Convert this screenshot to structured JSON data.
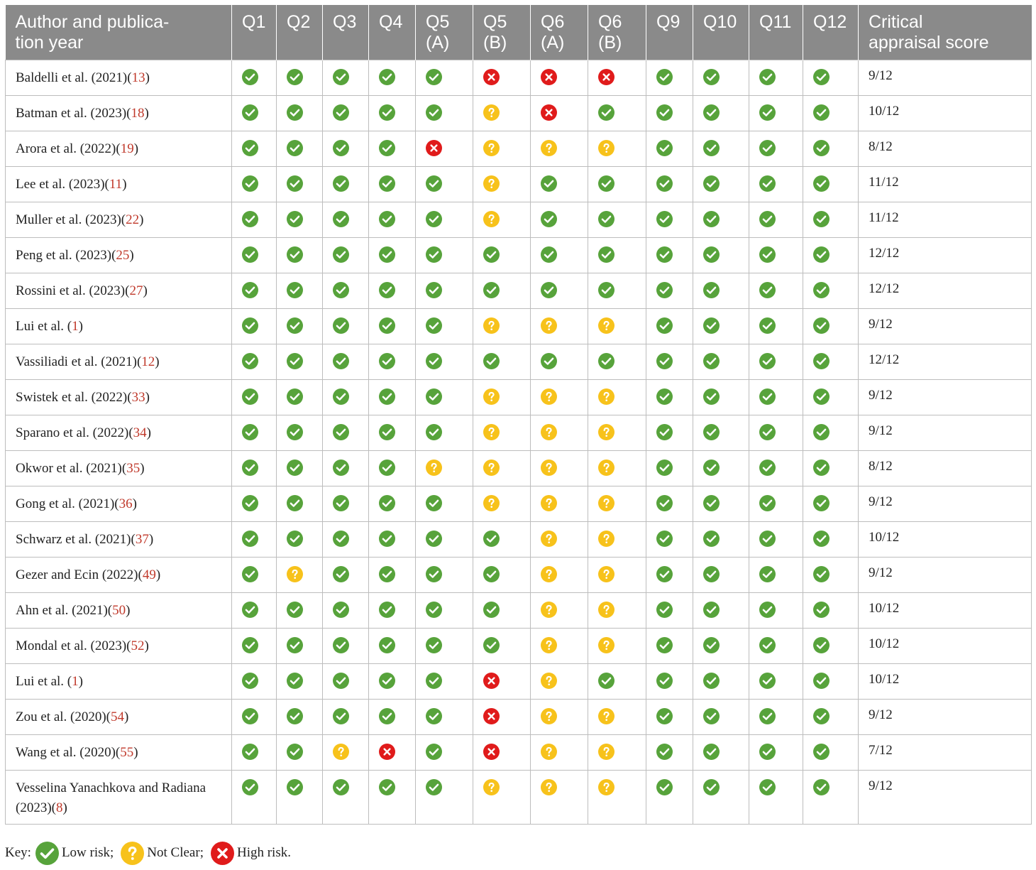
{
  "header": {
    "author": [
      "Author and publica-",
      "tion year"
    ],
    "questions": [
      [
        "Q1"
      ],
      [
        "Q2"
      ],
      [
        "Q3"
      ],
      [
        "Q4"
      ],
      [
        "Q5",
        "(A)"
      ],
      [
        "Q5",
        "(B)"
      ],
      [
        "Q6",
        "(A)"
      ],
      [
        "Q6",
        "(B)"
      ],
      [
        "Q9"
      ],
      [
        "Q10"
      ],
      [
        "Q11"
      ],
      [
        "Q12"
      ]
    ],
    "score": [
      "Critical",
      "appraisal score"
    ]
  },
  "rows": [
    {
      "author": "Baldelli et al. (2021)(",
      "ref": "13",
      "close": ")",
      "marks": [
        "low",
        "low",
        "low",
        "low",
        "low",
        "high",
        "high",
        "high",
        "low",
        "low",
        "low",
        "low"
      ],
      "score": "9/12"
    },
    {
      "author": "Batman et al. (2023)(",
      "ref": "18",
      "close": ")",
      "marks": [
        "low",
        "low",
        "low",
        "low",
        "low",
        "unclear",
        "high",
        "low",
        "low",
        "low",
        "low",
        "low"
      ],
      "score": "10/12"
    },
    {
      "author": "Arora et al. (2022)(",
      "ref": "19",
      "close": ")",
      "marks": [
        "low",
        "low",
        "low",
        "low",
        "high",
        "unclear",
        "unclear",
        "unclear",
        "low",
        "low",
        "low",
        "low"
      ],
      "score": "8/12"
    },
    {
      "author": "Lee et al. (2023)(",
      "ref": "11",
      "close": ")",
      "marks": [
        "low",
        "low",
        "low",
        "low",
        "low",
        "unclear",
        "low",
        "low",
        "low",
        "low",
        "low",
        "low"
      ],
      "score": "11/12"
    },
    {
      "author": "Muller et al. (2023)(",
      "ref": "22",
      "close": ")",
      "marks": [
        "low",
        "low",
        "low",
        "low",
        "low",
        "unclear",
        "low",
        "low",
        "low",
        "low",
        "low",
        "low"
      ],
      "score": "11/12"
    },
    {
      "author": "Peng et al. (2023)(",
      "ref": "25",
      "close": ")",
      "marks": [
        "low",
        "low",
        "low",
        "low",
        "low",
        "low",
        "low",
        "low",
        "low",
        "low",
        "low",
        "low"
      ],
      "score": "12/12"
    },
    {
      "author": "Rossini et al. (2023)(",
      "ref": "27",
      "close": ")",
      "marks": [
        "low",
        "low",
        "low",
        "low",
        "low",
        "low",
        "low",
        "low",
        "low",
        "low",
        "low",
        "low"
      ],
      "score": "12/12"
    },
    {
      "author": "Lui et al. (",
      "ref": "1",
      "close": ")",
      "marks": [
        "low",
        "low",
        "low",
        "low",
        "low",
        "unclear",
        "unclear",
        "unclear",
        "low",
        "low",
        "low",
        "low"
      ],
      "score": "9/12"
    },
    {
      "author": "Vassiliadi et al. (2021)(",
      "ref": "12",
      "close": ")",
      "marks": [
        "low",
        "low",
        "low",
        "low",
        "low",
        "low",
        "low",
        "low",
        "low",
        "low",
        "low",
        "low"
      ],
      "score": "12/12"
    },
    {
      "author": "Swistek et al. (2022)(",
      "ref": "33",
      "close": ")",
      "marks": [
        "low",
        "low",
        "low",
        "low",
        "low",
        "unclear",
        "unclear",
        "unclear",
        "low",
        "low",
        "low",
        "low"
      ],
      "score": "9/12"
    },
    {
      "author": "Sparano et al. (2022)(",
      "ref": "34",
      "close": ")",
      "marks": [
        "low",
        "low",
        "low",
        "low",
        "low",
        "unclear",
        "unclear",
        "unclear",
        "low",
        "low",
        "low",
        "low"
      ],
      "score": "9/12"
    },
    {
      "author": "Okwor et al. (2021)(",
      "ref": "35",
      "close": ")",
      "marks": [
        "low",
        "low",
        "low",
        "low",
        "unclear",
        "unclear",
        "unclear",
        "unclear",
        "low",
        "low",
        "low",
        "low"
      ],
      "score": "8/12"
    },
    {
      "author": "Gong et al. (2021)(",
      "ref": "36",
      "close": ")",
      "marks": [
        "low",
        "low",
        "low",
        "low",
        "low",
        "unclear",
        "unclear",
        "unclear",
        "low",
        "low",
        "low",
        "low"
      ],
      "score": "9/12"
    },
    {
      "author": "Schwarz et al. (2021)(",
      "ref": "37",
      "close": ")",
      "marks": [
        "low",
        "low",
        "low",
        "low",
        "low",
        "low",
        "unclear",
        "unclear",
        "low",
        "low",
        "low",
        "low"
      ],
      "score": "10/12"
    },
    {
      "author": "Gezer and Ecin (2022)(",
      "ref": "49",
      "close": ")",
      "marks": [
        "low",
        "unclear",
        "low",
        "low",
        "low",
        "low",
        "unclear",
        "unclear",
        "low",
        "low",
        "low",
        "low"
      ],
      "score": "9/12"
    },
    {
      "author": "Ahn et al. (2021)(",
      "ref": "50",
      "close": ")",
      "marks": [
        "low",
        "low",
        "low",
        "low",
        "low",
        "low",
        "unclear",
        "unclear",
        "low",
        "low",
        "low",
        "low"
      ],
      "score": "10/12"
    },
    {
      "author": "Mondal et al. (2023)(",
      "ref": "52",
      "close": ")",
      "marks": [
        "low",
        "low",
        "low",
        "low",
        "low",
        "low",
        "unclear",
        "unclear",
        "low",
        "low",
        "low",
        "low"
      ],
      "score": "10/12"
    },
    {
      "author": "Lui et al. (",
      "ref": "1",
      "close": ")",
      "marks": [
        "low",
        "low",
        "low",
        "low",
        "low",
        "high",
        "unclear",
        "low",
        "low",
        "low",
        "low",
        "low"
      ],
      "score": "10/12"
    },
    {
      "author": "Zou et al. (2020)(",
      "ref": "54",
      "close": ")",
      "marks": [
        "low",
        "low",
        "low",
        "low",
        "low",
        "high",
        "unclear",
        "unclear",
        "low",
        "low",
        "low",
        "low"
      ],
      "score": "9/12"
    },
    {
      "author": "Wang et al. (2020)(",
      "ref": "55",
      "close": ")",
      "marks": [
        "low",
        "low",
        "unclear",
        "high",
        "low",
        "high",
        "unclear",
        "unclear",
        "low",
        "low",
        "low",
        "low"
      ],
      "score": "7/12"
    },
    {
      "author": "Vesselina Yanachkova and Radiana (2023)(",
      "ref": "8",
      "close": ")",
      "marks": [
        "low",
        "low",
        "low",
        "low",
        "low",
        "unclear",
        "unclear",
        "unclear",
        "low",
        "low",
        "low",
        "low"
      ],
      "score": "9/12"
    }
  ],
  "key": {
    "prefix": "Key:",
    "low": "Low risk;",
    "unclear": "Not Clear;",
    "high": "High risk."
  },
  "colors": {
    "low": "#57a33b",
    "unclear": "#f7c21b",
    "high": "#e01b1b",
    "header_bg": "#8a8a8a",
    "ref": "#c0392b"
  },
  "icons": {
    "low": "check-icon",
    "unclear": "question-icon",
    "high": "cross-icon"
  }
}
